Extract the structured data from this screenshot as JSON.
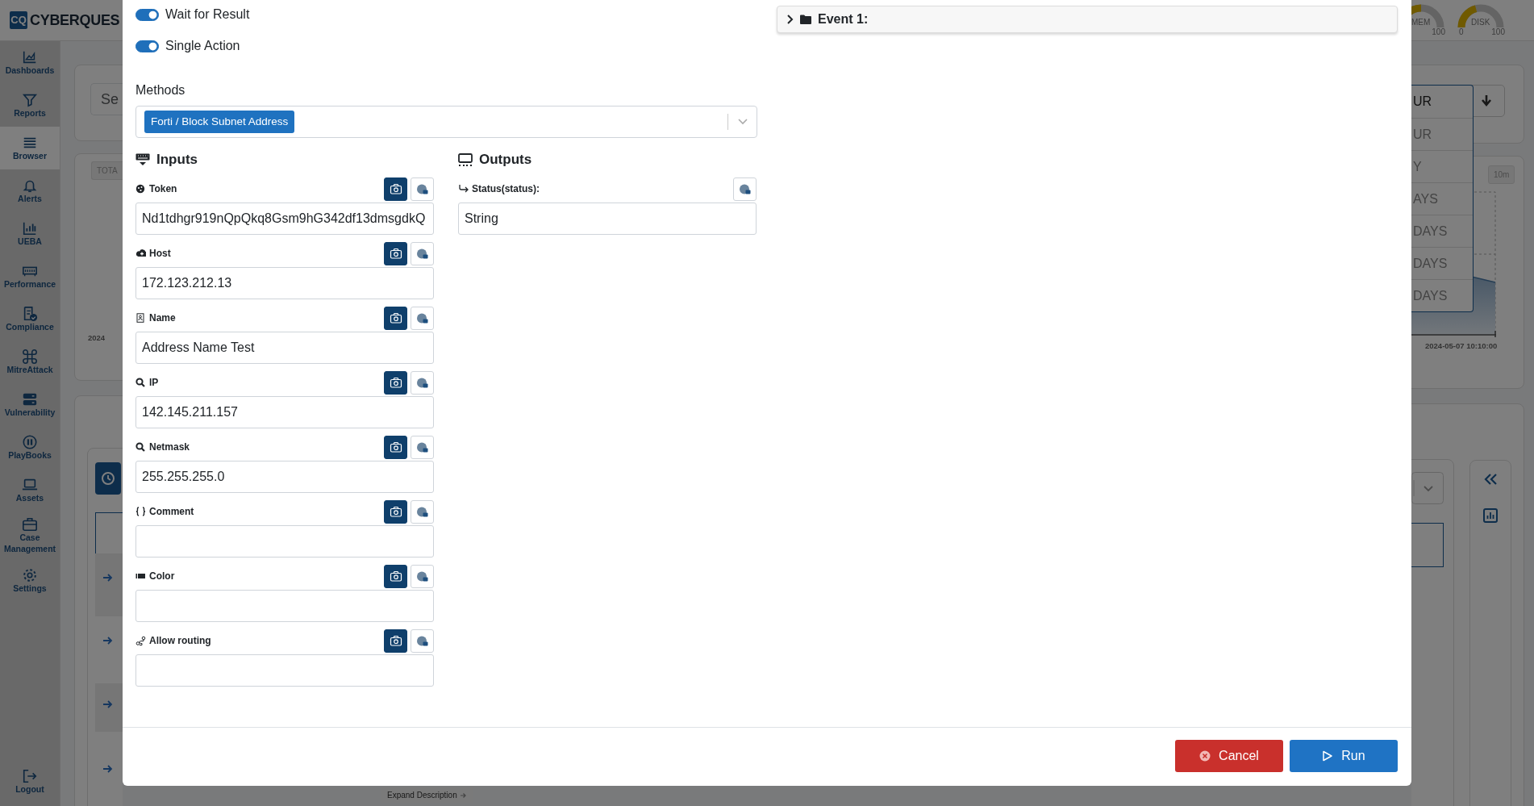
{
  "header": {
    "logo_mark": "CQ",
    "logo_text": "CYBERQUES",
    "gauges": [
      {
        "label": "MEM",
        "max": "100",
        "level": 0.5
      },
      {
        "label": "DISK",
        "min": "0",
        "max": "100",
        "level": 0.42
      }
    ]
  },
  "sidebar": {
    "items": [
      {
        "label": "Dashboards",
        "selected": false
      },
      {
        "label": "Reports",
        "selected": false
      },
      {
        "label": "Browser",
        "selected": true
      },
      {
        "label": "Alerts",
        "selected": false
      },
      {
        "label": "UEBA",
        "selected": false
      },
      {
        "label": "Performance",
        "selected": false
      },
      {
        "label": "Compliance",
        "selected": false
      },
      {
        "label": "MitreAttack",
        "selected": false
      },
      {
        "label": "Vulnerability",
        "selected": false
      },
      {
        "label": "PlayBooks",
        "selected": false
      },
      {
        "label": "Assets",
        "selected": false
      },
      {
        "label": "Case Management",
        "selected": false
      },
      {
        "label": "Settings",
        "selected": false
      }
    ],
    "logout": "Logout"
  },
  "page_behind": {
    "search": {
      "placeholder": "Se"
    },
    "total_tab": "TOTA",
    "axis_start": "2024",
    "range_options": [
      {
        "label": "UR",
        "selected": true
      },
      {
        "label": "UR",
        "selected": false
      },
      {
        "label": "Y",
        "selected": false
      },
      {
        "label": "AYS",
        "selected": false
      },
      {
        "label": "DAYS",
        "selected": false
      },
      {
        "label": "DAYS",
        "selected": false
      },
      {
        "label": "DAYS",
        "selected": false
      }
    ],
    "interval": "10m",
    "axis_end": "2024-05-07 10:10:00",
    "expand_link": "Expand Description"
  },
  "modal": {
    "toggles": [
      {
        "label": "Wait for Result",
        "on": true
      },
      {
        "label": "Single Action",
        "on": true
      }
    ],
    "methods": {
      "label": "Methods",
      "selected": [
        "Forti / Block Subnet Address"
      ]
    },
    "inputs": {
      "title": "Inputs",
      "fields": [
        {
          "label": "Token",
          "value": "Nd1tdhgr919nQpQkq8Gsm9hG342df13dmsgdkQ"
        },
        {
          "label": "Host",
          "value": "172.123.212.13"
        },
        {
          "label": "Name",
          "value": "Address Name Test"
        },
        {
          "label": "IP",
          "value": "142.145.211.157"
        },
        {
          "label": "Netmask",
          "value": "255.255.255.0"
        },
        {
          "label": "Comment"
        },
        {
          "label": "Color"
        },
        {
          "label": "Allow routing"
        }
      ]
    },
    "outputs": {
      "title": "Outputs",
      "fields": [
        {
          "label": "Status(status):",
          "value": "String"
        }
      ]
    },
    "event": {
      "label": "Event 1:",
      "expanded": false
    },
    "buttons": [
      {
        "label": "Cancel",
        "kind": "danger"
      },
      {
        "label": "Run",
        "kind": "primary"
      }
    ]
  }
}
